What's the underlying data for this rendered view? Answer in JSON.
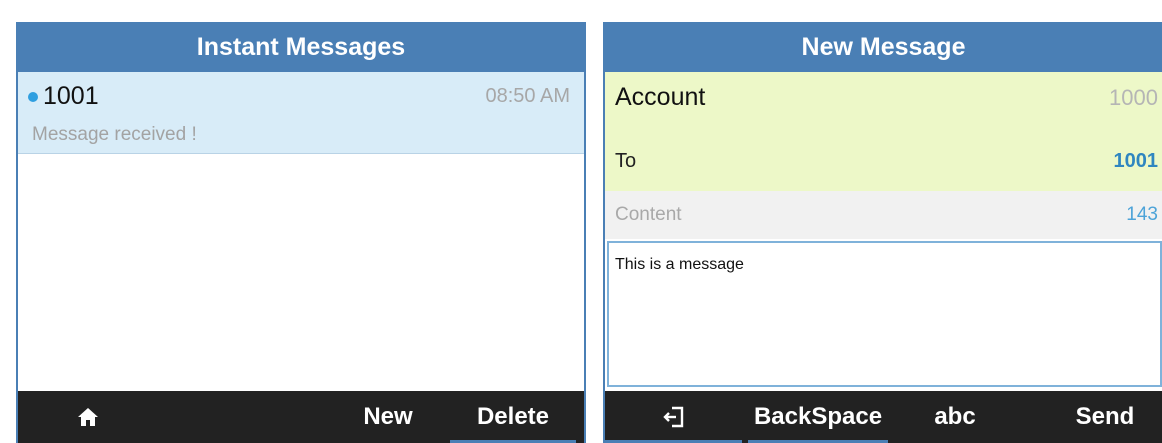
{
  "left_screen": {
    "title": "Instant Messages",
    "messages": [
      {
        "sender": "1001",
        "time": "08:50 AM",
        "preview": "Message received !",
        "unread": true
      }
    ],
    "softkeys": {
      "home_icon": "home-icon",
      "new_label": "New",
      "delete_label": "Delete"
    }
  },
  "right_screen": {
    "title": "New Message",
    "account_label": "Account",
    "account_value": "1000",
    "to_label": "To",
    "to_value": "1001",
    "content_label": "Content",
    "content_remaining": "143",
    "content_text": "This is a message",
    "softkeys": {
      "exit_icon": "exit-icon",
      "backspace_label": "BackSpace",
      "input_mode_label": "abc",
      "send_label": "Send"
    }
  },
  "colors": {
    "title_bar": "#4a7fb5",
    "selected_row": "#d8ecf8",
    "form_highlight": "#edf8c8",
    "softkey_bar": "#222222",
    "unread_dot": "#2f9fe0"
  }
}
